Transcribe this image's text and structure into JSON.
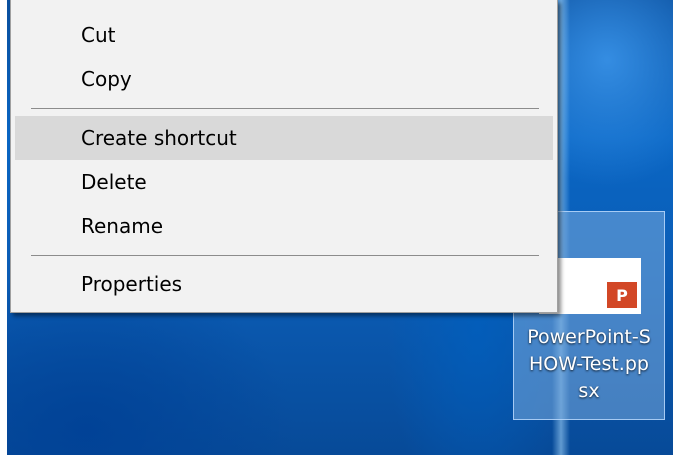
{
  "context_menu": {
    "items": [
      {
        "label": "Cut"
      },
      {
        "label": "Copy"
      },
      {
        "label": "Create shortcut",
        "highlighted": true
      },
      {
        "label": "Delete"
      },
      {
        "label": "Rename"
      },
      {
        "label": "Properties"
      }
    ]
  },
  "desktop_icon": {
    "name_lines": [
      "PowerPoint-S",
      "HOW-Test.pp",
      "sx"
    ],
    "badge_text": "P",
    "icon": "powerpoint-show-file-icon",
    "selected": true
  },
  "colors": {
    "menu_background": "#f2f2f2",
    "menu_highlight": "#d9d9d9",
    "desktop_blue": "#0a66c4",
    "powerpoint_orange": "#d24726"
  }
}
